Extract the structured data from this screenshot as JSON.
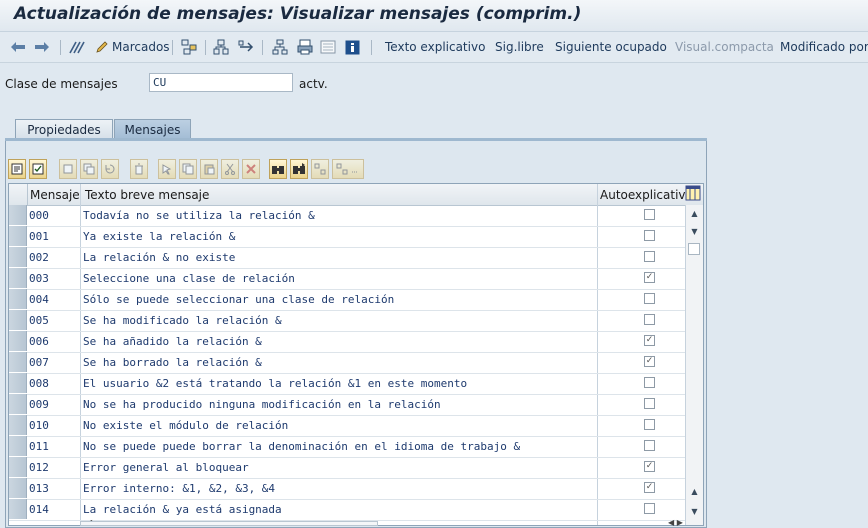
{
  "window": {
    "title": "Actualización de mensajes: Visualizar mensajes (comprim.)"
  },
  "toolbar": {
    "marcados": "Marcados",
    "texto_explicativo": "Texto explicativo",
    "sig_libre": "Sig.libre",
    "siguiente_ocupado": "Siguiente ocupado",
    "visual_compacta": "Visual.compacta",
    "modificado_por": "Modificado por"
  },
  "header_fields": {
    "clase_label": "Clase de mensajes",
    "clase_value": "CU",
    "status": "actv."
  },
  "tabs": [
    {
      "label": "Propiedades",
      "active": false
    },
    {
      "label": "Mensajes",
      "active": true
    }
  ],
  "table": {
    "columns": {
      "mensaje": "Mensaje",
      "texto": "Texto breve mensaje",
      "auto": "Autoexplicativo"
    },
    "rows": [
      {
        "num": "000",
        "text": "Todavía no se utiliza la relación &",
        "checked": false
      },
      {
        "num": "001",
        "text": "Ya existe la relación &",
        "checked": false
      },
      {
        "num": "002",
        "text": "La relación & no existe",
        "checked": false
      },
      {
        "num": "003",
        "text": "Seleccione una clase de relación",
        "checked": true
      },
      {
        "num": "004",
        "text": "Sólo se puede seleccionar una clase de relación",
        "checked": false
      },
      {
        "num": "005",
        "text": "Se ha modificado la relación &",
        "checked": false
      },
      {
        "num": "006",
        "text": "Se ha añadido la relación &",
        "checked": true
      },
      {
        "num": "007",
        "text": "Se ha borrado la relación &",
        "checked": true
      },
      {
        "num": "008",
        "text": "El usuario &2 está tratando la relación &1 en este momento",
        "checked": false
      },
      {
        "num": "009",
        "text": "No se ha producido ninguna modificación en la relación",
        "checked": false
      },
      {
        "num": "010",
        "text": "No existe el módulo de relación",
        "checked": false
      },
      {
        "num": "011",
        "text": "No se puede puede borrar la denominación en el idioma de trabajo &",
        "checked": false
      },
      {
        "num": "012",
        "text": "Error general al bloquear",
        "checked": true
      },
      {
        "num": "013",
        "text": "Error interno: &1, &2, &3, &4",
        "checked": true
      },
      {
        "num": "014",
        "text": "La relación & ya está asignada",
        "checked": false
      }
    ]
  },
  "colors": {
    "accent": "#1e3a6e",
    "background": "#dfe8f0",
    "tab_active": "#a3bdd5"
  },
  "icons": [
    "back-icon",
    "forward-icon",
    "other-object-icon",
    "edit-pencil-icon",
    "hierarchy-icon",
    "where-used-icon",
    "navigate-icon",
    "tree-icon",
    "print-icon",
    "display-icon",
    "info-icon",
    "column-layout-icon"
  ]
}
